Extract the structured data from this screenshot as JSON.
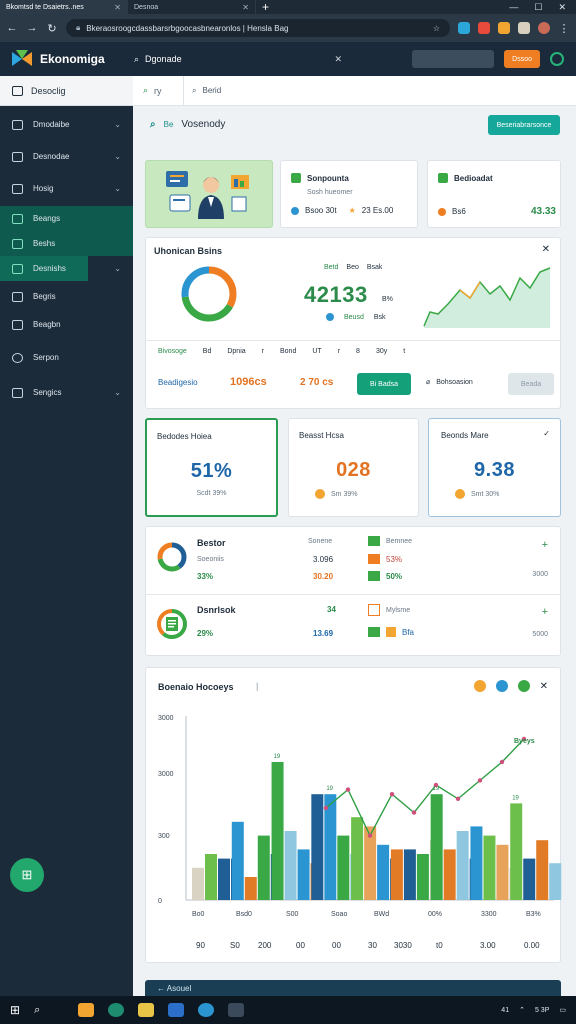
{
  "browser": {
    "tabs": [
      {
        "label": "Bkomtsd te Dsaietrs..nes",
        "active": true
      },
      {
        "label": "Desnoa",
        "active": false
      }
    ],
    "new_tab": "+",
    "url": "Bkeraosroogcdassbarsrbgoocasbnearonlos | Hensla Bag",
    "window_controls": [
      "—",
      "☐",
      "✕"
    ]
  },
  "app": {
    "name": "Ekonomiga",
    "search_placeholder": "Dgonade",
    "search_close": "✕",
    "cta_label": "Dssoo"
  },
  "sidebar": {
    "top_label": "Desoclig",
    "items": [
      {
        "label": "Dmodaibe",
        "chev": "⌄",
        "highlight": false
      },
      {
        "label": "Desnodae",
        "chev": "⌄",
        "highlight": false
      },
      {
        "label": "Hosig",
        "chev": "⌄",
        "highlight": false
      },
      {
        "label": "Beangs",
        "chev": "",
        "highlight": true
      },
      {
        "label": "Beshs",
        "chev": "",
        "highlight": true
      },
      {
        "label": "Desnishs",
        "chev": "⌄",
        "highlight": true
      },
      {
        "label": "Begris",
        "chev": "",
        "highlight": false
      },
      {
        "label": "Beagbn",
        "chev": "",
        "highlight": false
      },
      {
        "label": "Serpon",
        "chev": "",
        "highlight": false
      },
      {
        "label": "Sengics",
        "chev": "⌄",
        "highlight": false
      }
    ],
    "fab_icon": "⊞"
  },
  "topsearch": {
    "left_label": "ry",
    "placeholder": "Berid"
  },
  "breadcrumb": {
    "prefix": "Be",
    "title": "Vosenody"
  },
  "header_button": "Beseriabrarsonce",
  "summary_cards": [
    {
      "title": "Sonpounta",
      "sub": "Sosh hueomer",
      "stat1": "Bsoo 30t",
      "stat2": "23 Es.00"
    },
    {
      "title": "Bedioadat",
      "sub": "",
      "stat1": "Bs6",
      "stat2": "43.33"
    }
  ],
  "overview": {
    "title": "Uhonican Bsins",
    "close": "✕",
    "big_number": "42133",
    "legend_top": [
      "Betd",
      "Beo",
      "Bsak"
    ],
    "legend_mid": "B%",
    "legend_bot": [
      "Beusd",
      "Bsk"
    ],
    "table_row1": [
      "Bivosoge",
      "Bd",
      "Dpnia",
      "r",
      "Bond",
      "UT",
      "r",
      "8",
      "30y",
      "t"
    ],
    "table_row2_label": "Beadigesio",
    "table_row2_val1": "1096cs",
    "table_row2_val2": "2 70 cs",
    "btn_primary": "Bi Badsa",
    "link": "Bohsoasion",
    "btn_disabled": "Beada"
  },
  "kpis": [
    {
      "title": "Bedodes Hoiea",
      "value": "51%",
      "sub": "Scdt 39%",
      "color": "#1d66a8"
    },
    {
      "title": "Beasst Hcsa",
      "value": "028",
      "sub": "Sm 39%",
      "color": "#e37322"
    },
    {
      "title": "Beonds Mare",
      "value": "9.38",
      "sub": "Smt 30%",
      "color": "#1d66a8"
    }
  ],
  "list_rows": [
    {
      "title": "Bestor",
      "sub": "Soeoniis",
      "value": "33%",
      "col2_label": "Sonene",
      "col2_val1": "3.096",
      "col2_val2": "30.20",
      "col3_label": "Bemnee",
      "col3_val1": "53%",
      "col3_val2": "50%",
      "end": "3000"
    },
    {
      "title": "Dsnrlsok",
      "sub": "",
      "value": "29%",
      "col2_label": "34",
      "col2_val1": "13.69",
      "col2_val2": "",
      "col3_label": "Mylsme",
      "col3_val1": "Bfa",
      "col3_val2": "",
      "end": "5000"
    }
  ],
  "chart_card": {
    "title": "Boenaio Hocoeys",
    "close": "✕"
  },
  "chart_data": {
    "type": "bar",
    "title": "Boenaio Hocoeys",
    "ylabels": [
      "3000",
      "3000",
      "300",
      "0"
    ],
    "xlabels_top": [
      "Bo0",
      "Bsd0",
      "S00",
      "Soao",
      "BWd",
      "00%",
      "3300",
      "B3%"
    ],
    "xlabels_bottom": [
      "90",
      "S0",
      "200",
      "00",
      "00",
      "30",
      "3030",
      "t0",
      "3.00",
      "0.00"
    ],
    "line_annotation": "Byeys",
    "bar_labels": [
      "19",
      "19",
      "19",
      "19"
    ],
    "groups": [
      {
        "values": [
          700,
          1000,
          900,
          900
        ],
        "colors": [
          "#d8d3c3",
          "#6bbf4a",
          "#1f5f95",
          "#1f5f95"
        ]
      },
      {
        "values": [
          1700,
          500,
          1400,
          1000
        ],
        "colors": [
          "#2b95d1",
          "#e27b26",
          "#39a845",
          "#1f5f95"
        ]
      },
      {
        "values": [
          3000,
          1500,
          1100,
          800
        ],
        "colors": [
          "#39a845",
          "#8fc6e0",
          "#2b95d1",
          "#e27b26"
        ]
      },
      {
        "values": [
          2300,
          2300,
          1400,
          1000
        ],
        "colors": [
          "#1f5f95",
          "#2b95d1",
          "#39a845",
          "#8fc6e0"
        ]
      },
      {
        "values": [
          1800,
          1600,
          1200,
          900
        ],
        "colors": [
          "#6bbf4a",
          "#e8a35a",
          "#2b95d1",
          "#1f5f95"
        ]
      },
      {
        "values": [
          1100,
          1100,
          1000,
          1300
        ],
        "colors": [
          "#e27b26",
          "#1f5f95",
          "#39a845",
          "#d8d3c3"
        ]
      },
      {
        "values": [
          2300,
          1100,
          1500,
          900
        ],
        "colors": [
          "#39a845",
          "#e27b26",
          "#8fc6e0",
          "#1f5f95"
        ]
      },
      {
        "values": [
          1600,
          1400,
          1200,
          700
        ],
        "colors": [
          "#2b95d1",
          "#6bbf4a",
          "#e8a35a",
          "#d8d3c3"
        ]
      },
      {
        "values": [
          2100,
          900,
          1300,
          800
        ],
        "colors": [
          "#6bbf4a",
          "#1f5f95",
          "#e27b26",
          "#8fc6e0"
        ]
      }
    ],
    "line": [
      2000,
      2400,
      1400,
      2300,
      1900,
      2500,
      2200,
      2600,
      3000,
      3500
    ],
    "ylim": [
      0,
      4000
    ]
  },
  "taskbar": {
    "dock_label": "← Asouel",
    "tray_text": "41",
    "clock": "5 3P"
  }
}
